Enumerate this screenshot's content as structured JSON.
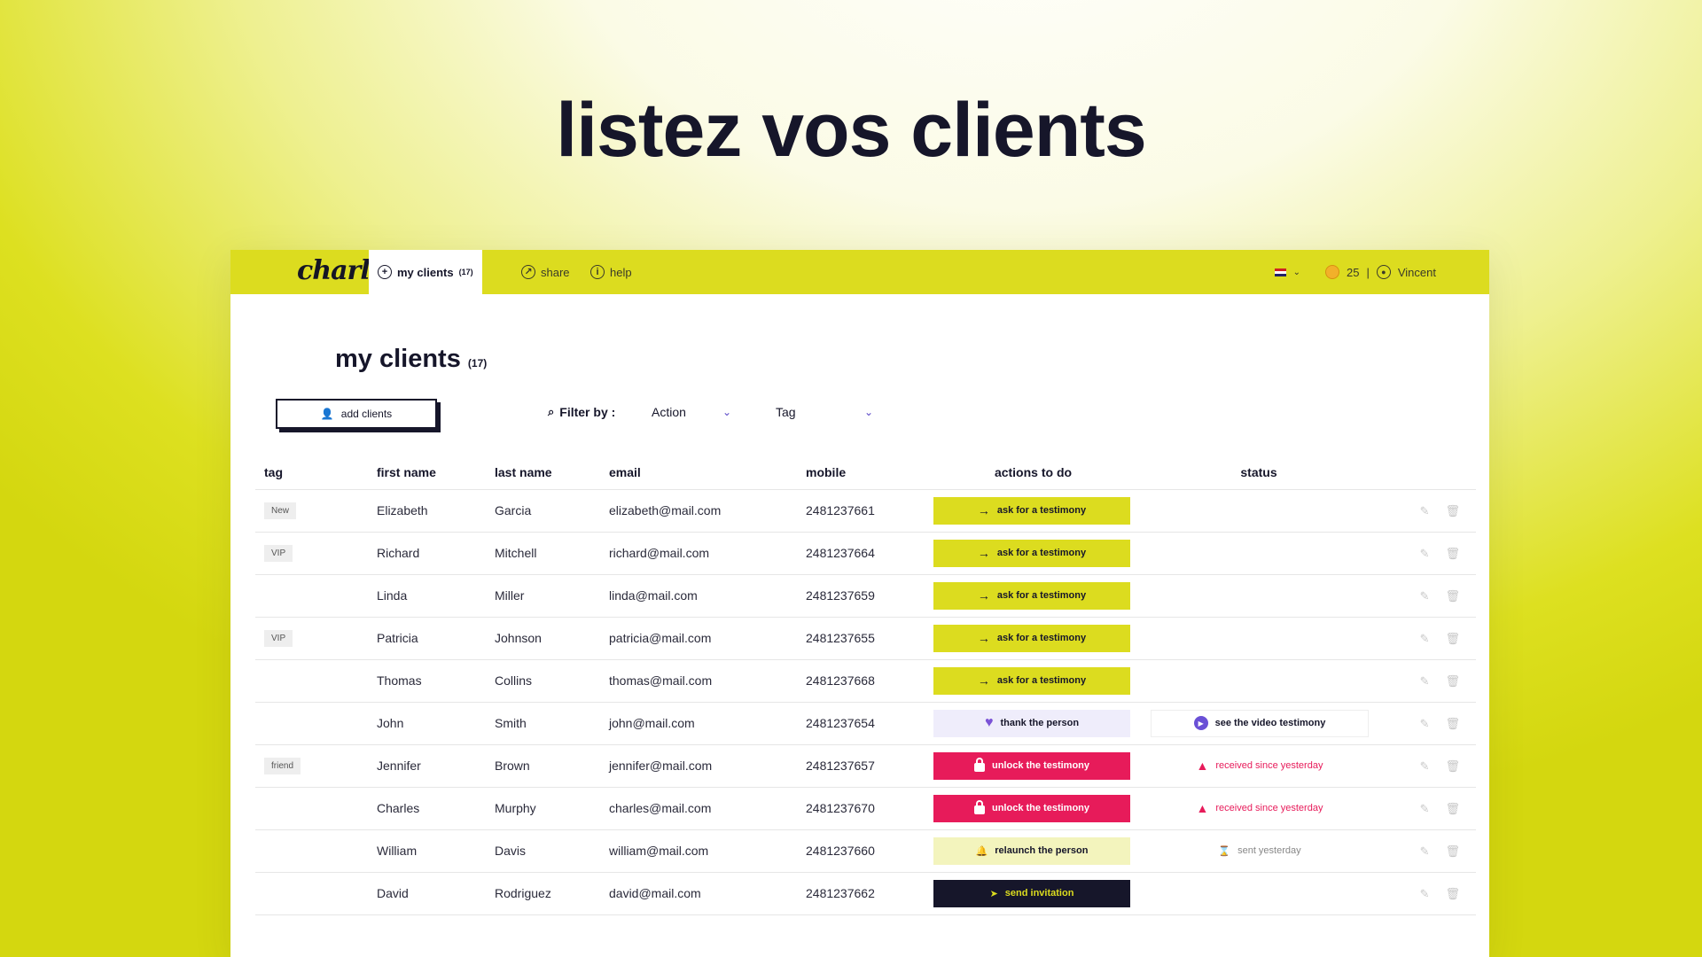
{
  "hero": {
    "title": "listez vos clients"
  },
  "nav": {
    "logo": "charlie",
    "tabs": [
      {
        "label": "my clients",
        "count": "(17)",
        "icon": "plus-circle-icon"
      },
      {
        "label": "share",
        "icon": "share-icon"
      },
      {
        "label": "help",
        "icon": "info-icon"
      }
    ],
    "credits": "25",
    "user": "Vincent"
  },
  "page": {
    "title": "my clients",
    "count": "(17)",
    "add_button": "add clients",
    "filter_label": "Filter by :",
    "filter_action": "Action",
    "filter_tag": "Tag"
  },
  "table": {
    "headers": [
      "tag",
      "first name",
      "last name",
      "email",
      "mobile",
      "actions to do",
      "status"
    ],
    "rows": [
      {
        "tag": "New",
        "first": "Elizabeth",
        "last": "Garcia",
        "email": "elizabeth@mail.com",
        "mobile": "2481237661",
        "action": "ask for a testimony",
        "action_style": "yellow",
        "status": ""
      },
      {
        "tag": "VIP",
        "first": "Richard",
        "last": "Mitchell",
        "email": "richard@mail.com",
        "mobile": "2481237664",
        "action": "ask for a testimony",
        "action_style": "yellow",
        "status": ""
      },
      {
        "tag": "",
        "first": "Linda",
        "last": "Miller",
        "email": "linda@mail.com",
        "mobile": "2481237659",
        "action": "ask for a testimony",
        "action_style": "yellow",
        "status": ""
      },
      {
        "tag": "VIP",
        "first": "Patricia",
        "last": "Johnson",
        "email": "patricia@mail.com",
        "mobile": "2481237655",
        "action": "ask for a testimony",
        "action_style": "yellow",
        "status": ""
      },
      {
        "tag": "",
        "first": "Thomas",
        "last": "Collins",
        "email": "thomas@mail.com",
        "mobile": "2481237668",
        "action": "ask for a testimony",
        "action_style": "yellow",
        "status": ""
      },
      {
        "tag": "",
        "first": "John",
        "last": "Smith",
        "email": "john@mail.com",
        "mobile": "2481237654",
        "action": "thank the person",
        "action_style": "lilac",
        "status": "see the video testimony",
        "status_style": "video"
      },
      {
        "tag": "friend",
        "first": "Jennifer",
        "last": "Brown",
        "email": "jennifer@mail.com",
        "mobile": "2481237657",
        "action": "unlock the testimony",
        "action_style": "red",
        "status": "received since yesterday",
        "status_style": "warn"
      },
      {
        "tag": "",
        "first": "Charles",
        "last": "Murphy",
        "email": "charles@mail.com",
        "mobile": "2481237670",
        "action": "unlock the testimony",
        "action_style": "red",
        "status": "received since yesterday",
        "status_style": "warn"
      },
      {
        "tag": "",
        "first": "William",
        "last": "Davis",
        "email": "william@mail.com",
        "mobile": "2481237660",
        "action": "relaunch the person",
        "action_style": "pale",
        "status": "sent yesterday",
        "status_style": "sent"
      },
      {
        "tag": "",
        "first": "David",
        "last": "Rodriguez",
        "email": "david@mail.com",
        "mobile": "2481237662",
        "action": "send invitation",
        "action_style": "dark",
        "status": ""
      }
    ]
  },
  "colors": {
    "brand": "#dcdc1f",
    "dark": "#16162a",
    "alert": "#e71b5a",
    "accent": "#6a50d6"
  }
}
